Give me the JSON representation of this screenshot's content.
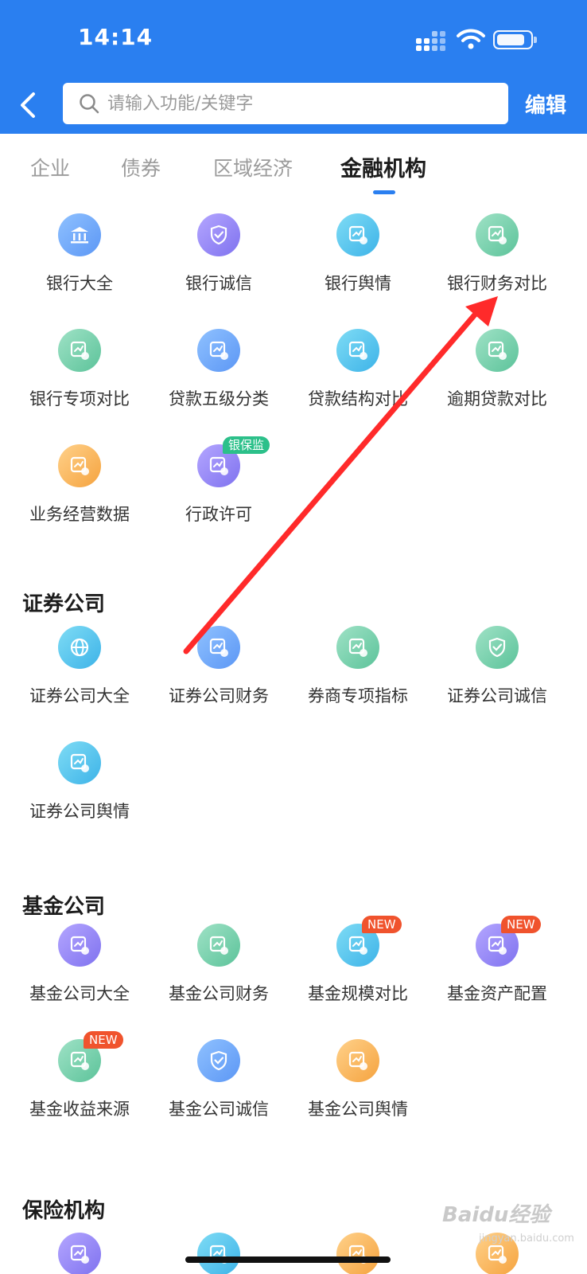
{
  "status_bar": {
    "time": "14:14"
  },
  "header": {
    "search_placeholder": "请输入功能/关键字",
    "edit_label": "编辑"
  },
  "tabs": [
    {
      "label": "企业"
    },
    {
      "label": "债券"
    },
    {
      "label": "区域经济"
    },
    {
      "label": "金融机构",
      "active": true
    }
  ],
  "bank_items": [
    {
      "label": "银行大全",
      "icon": "bank-building-icon",
      "color": "blue"
    },
    {
      "label": "银行诚信",
      "icon": "bank-shield-icon",
      "color": "purple"
    },
    {
      "label": "银行舆情",
      "icon": "bank-sentiment-icon",
      "color": "cyan"
    },
    {
      "label": "银行财务对比",
      "icon": "bank-compare-icon",
      "color": "green"
    },
    {
      "label": "银行专项对比",
      "icon": "bank-chart-icon",
      "color": "green"
    },
    {
      "label": "贷款五级分类",
      "icon": "loan-list-icon",
      "color": "blue"
    },
    {
      "label": "贷款结构对比",
      "icon": "loan-structure-icon",
      "color": "cyan"
    },
    {
      "label": "逾期贷款对比",
      "icon": "overdue-loan-icon",
      "color": "green"
    },
    {
      "label": "业务经营数据",
      "icon": "business-data-icon",
      "color": "orange"
    },
    {
      "label": "行政许可",
      "icon": "license-icon",
      "color": "purple",
      "badge": "银保监",
      "badge_color": "#2cc08a"
    }
  ],
  "securities": {
    "title": "证券公司",
    "items": [
      {
        "label": "证券公司大全",
        "icon": "globe-icon",
        "color": "cyan"
      },
      {
        "label": "证券公司财务",
        "icon": "securities-finance-icon",
        "color": "blue"
      },
      {
        "label": "券商专项指标",
        "icon": "broker-indicator-icon",
        "color": "green"
      },
      {
        "label": "证券公司诚信",
        "icon": "securities-shield-icon",
        "color": "green"
      },
      {
        "label": "证券公司舆情",
        "icon": "securities-sentiment-icon",
        "color": "cyan"
      }
    ]
  },
  "funds": {
    "title": "基金公司",
    "items": [
      {
        "label": "基金公司大全",
        "icon": "fund-building-icon",
        "color": "purple"
      },
      {
        "label": "基金公司财务",
        "icon": "fund-finance-icon",
        "color": "green"
      },
      {
        "label": "基金规模对比",
        "icon": "fund-scale-icon",
        "color": "cyan",
        "badge": "NEW",
        "badge_color": "#f0532d"
      },
      {
        "label": "基金资产配置",
        "icon": "fund-allocation-icon",
        "color": "purple",
        "badge": "NEW",
        "badge_color": "#f0532d"
      },
      {
        "label": "基金收益来源",
        "icon": "yen-return-icon",
        "color": "green",
        "badge": "NEW",
        "badge_color": "#f0532d"
      },
      {
        "label": "基金公司诚信",
        "icon": "fund-shield-icon",
        "color": "blue"
      },
      {
        "label": "基金公司舆情",
        "icon": "fund-sentiment-icon",
        "color": "orange"
      }
    ]
  },
  "insurance": {
    "title": "保险机构",
    "partial_icons": [
      {
        "icon": "insurance-building-icon",
        "color": "purple"
      },
      {
        "icon": "insurance-chart-icon",
        "color": "cyan"
      },
      {
        "icon": "insurance-list-icon",
        "color": "orange"
      },
      {
        "icon": "insurance-trend-icon",
        "color": "orange"
      }
    ]
  },
  "watermark": {
    "text": "Baidu经验",
    "sub": "jingyan.baidu.com"
  },
  "colors": {
    "header_blue": "#2a7ff0",
    "annotation_red": "#ff2a2a"
  }
}
